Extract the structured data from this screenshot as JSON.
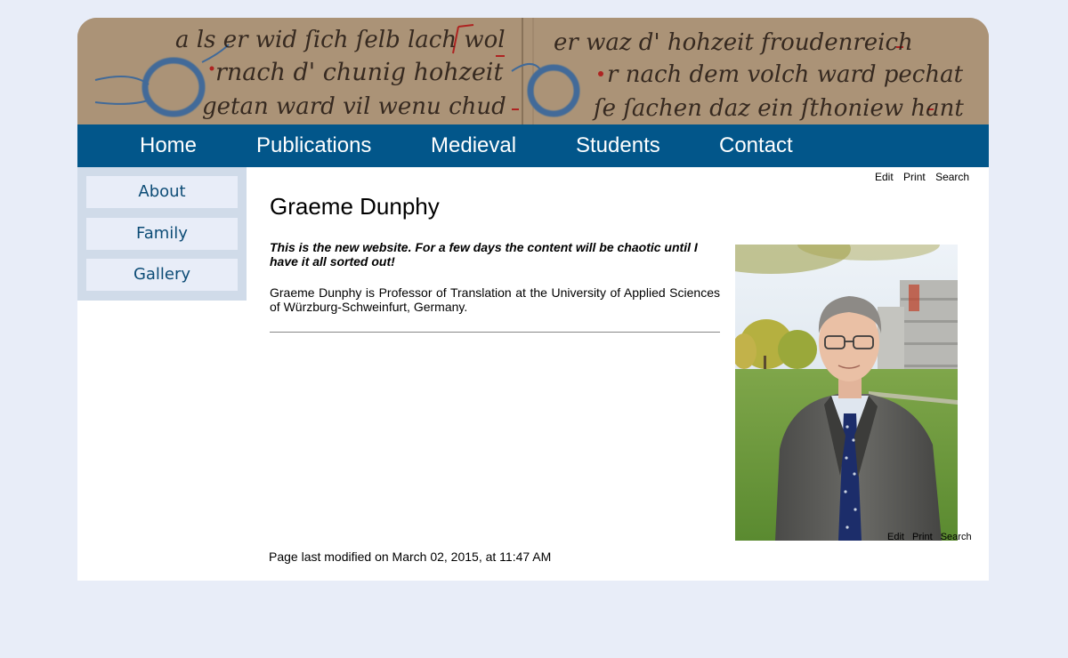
{
  "nav": {
    "items": [
      {
        "label": "Home"
      },
      {
        "label": "Publications"
      },
      {
        "label": "Medieval"
      },
      {
        "label": "Students"
      },
      {
        "label": "Contact"
      }
    ]
  },
  "sidebar": {
    "items": [
      {
        "label": "About"
      },
      {
        "label": "Family"
      },
      {
        "label": "Gallery"
      }
    ]
  },
  "actions": {
    "edit": "Edit",
    "print": "Print",
    "search": "Search"
  },
  "page": {
    "title": "Graeme Dunphy",
    "notice": "This is the new website. For a few days the content will be chaotic until I have it all sorted out!",
    "bio": "Graeme Dunphy is Professor of Translation at the University of Applied Sciences of Würzburg-Schweinfurt, Germany.",
    "footer": "Page last modified on March 02, 2015, at 11:47 AM"
  },
  "colors": {
    "background": "#e8edf8",
    "nav": "#02568a",
    "sidebar": "#d0dbe9",
    "sidebar_item": "#e8edf8",
    "sidebar_text": "#0d4c76"
  }
}
